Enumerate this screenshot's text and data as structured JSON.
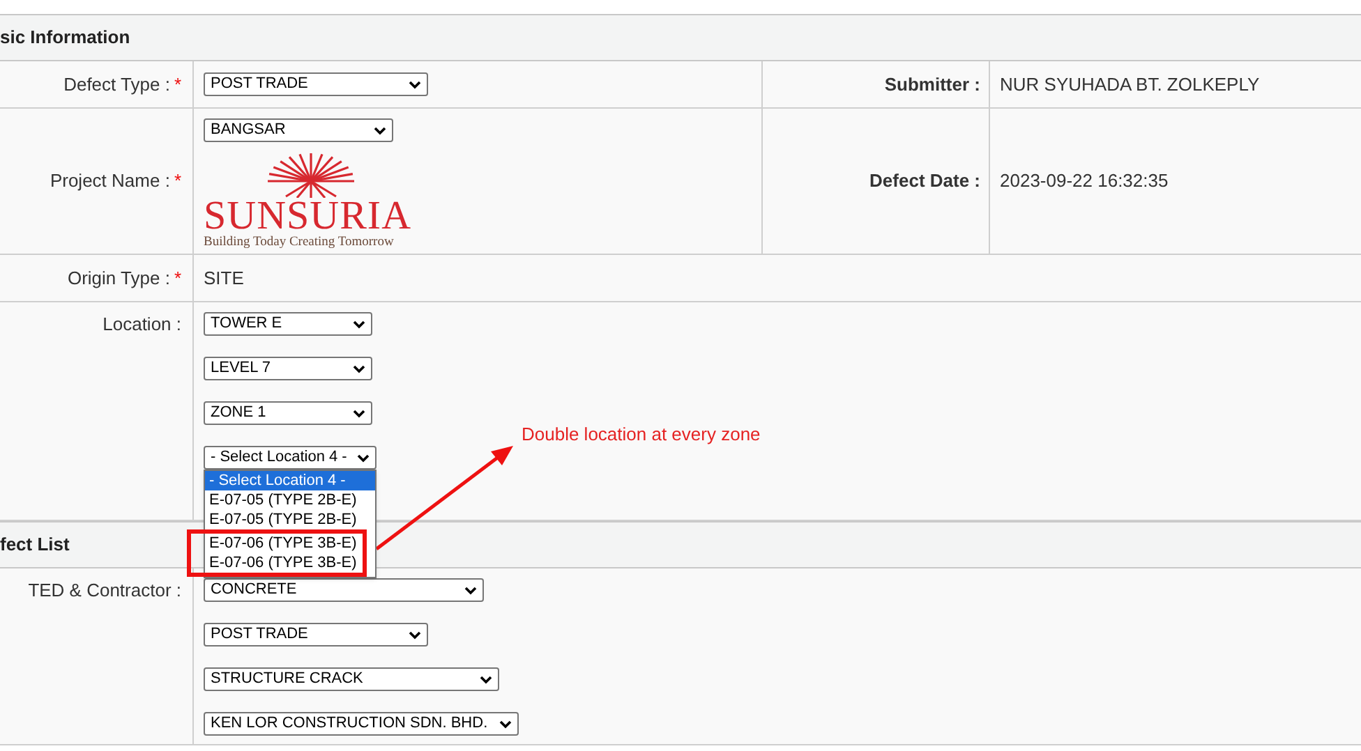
{
  "sections": [
    {
      "title": "sic Information",
      "rows": [
        {
          "label": "Defect Type :",
          "mark": "*",
          "kind": "selects",
          "selects": [
            {
              "value": "POST TRADE"
            }
          ],
          "side": {
            "label": "Submitter :",
            "value": "NUR SYUHADA BT. ZOLKEPLY"
          }
        },
        {
          "label": "Project Name :",
          "mark": "*",
          "kind": "selects",
          "selects": [
            {
              "value": "BANGSAR"
            }
          ],
          "logo": {
            "name": "SUNSURIA",
            "tagline": "Building Today Creating Tomorrow"
          },
          "side": {
            "label": "Defect Date :",
            "value": "2023-09-22 16:32:35"
          }
        },
        {
          "label": "Origin Type :",
          "mark": "*",
          "kind": "text",
          "value": "SITE"
        },
        {
          "label": "Location :",
          "kind": "selects",
          "selects": [
            {
              "value": "TOWER E"
            },
            {
              "value": "LEVEL 7"
            },
            {
              "value": "ZONE 1"
            },
            {
              "value": "- Select Location 4 -",
              "options": [
                {
                  "label": "- Select Location 4 -",
                  "selected": true
                },
                {
                  "label": "E-07-05 (TYPE 2B-E)",
                  "selected": false
                },
                {
                  "label": "E-07-05 (TYPE 2B-E)",
                  "selected": false
                },
                {
                  "label": "E-07-06 (TYPE 3B-E)",
                  "selected": false,
                  "highlighted": true
                },
                {
                  "label": "E-07-06 (TYPE 3B-E)",
                  "selected": false,
                  "highlighted": true
                }
              ]
            }
          ]
        }
      ]
    },
    {
      "title": "fect List",
      "rows": [
        {
          "label": "TED & Contractor :",
          "kind": "selects",
          "selects": [
            {
              "value": "CONCRETE"
            },
            {
              "value": "POST TRADE"
            },
            {
              "value": "STRUCTURE CRACK"
            },
            {
              "value": "KEN LOR CONSTRUCTION SDN. BHD."
            }
          ]
        }
      ]
    }
  ],
  "annotation": {
    "text": "Double location at every zone"
  }
}
